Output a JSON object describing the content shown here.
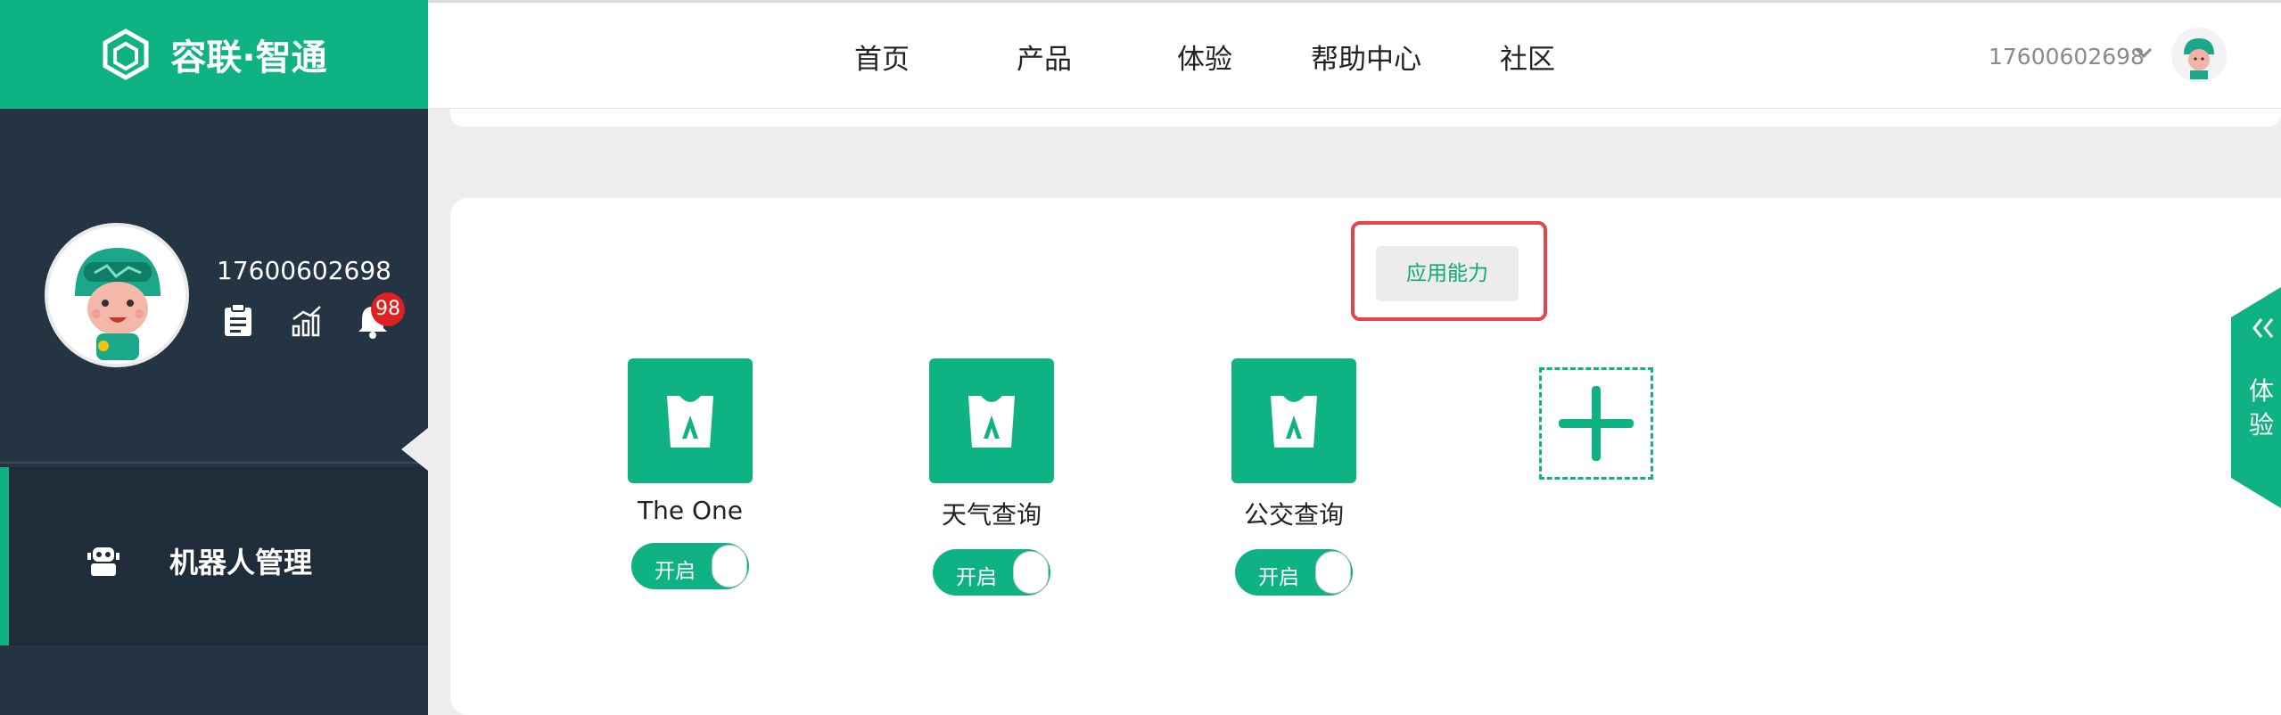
{
  "brand": {
    "name": "容联·智通"
  },
  "nav": {
    "items": [
      "首页",
      "产品",
      "体验",
      "帮助中心",
      "社区"
    ]
  },
  "user": {
    "phone": "17600602698",
    "notifications": "98"
  },
  "sidebar": {
    "menu_label": "机器人管理"
  },
  "main": {
    "capability_button": "应用能力",
    "apps": [
      {
        "name": "The One",
        "toggle": "开启"
      },
      {
        "name": "天气查询",
        "toggle": "开启"
      },
      {
        "name": "公交查询",
        "toggle": "开启"
      }
    ]
  },
  "side_tab": {
    "label": "体验"
  },
  "colors": {
    "brand": "#0fb283",
    "sidebar": "#253443",
    "highlight": "#e8414f",
    "badge": "#e02020"
  }
}
